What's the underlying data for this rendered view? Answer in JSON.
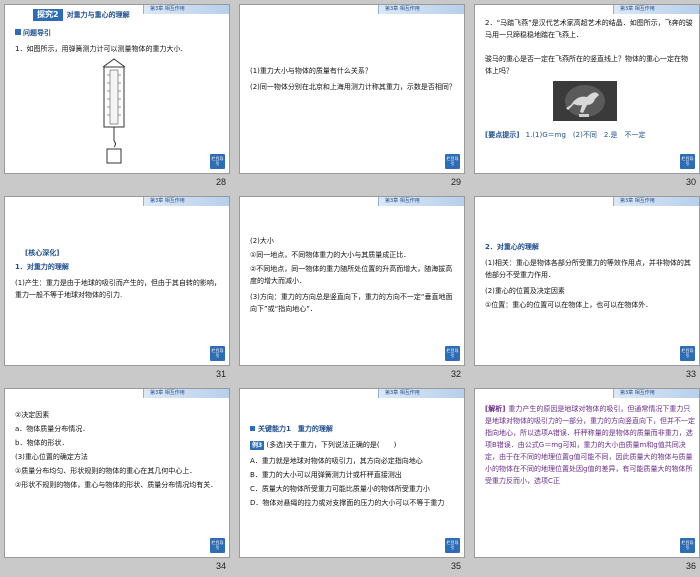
{
  "nav_label": "第3章 相互作用",
  "corner_label": "栏目导引",
  "slides": [
    {
      "number": "28",
      "section_tag": "探究2",
      "section_title": "对重力与重心的理解",
      "subhead": "问题导引",
      "lines": [
        "1．如图所示，用弹簧测力计可以测量物体的重力大小."
      ]
    },
    {
      "number": "29",
      "lines": [
        "(1)重力大小与物体的质量有什么关系？",
        "(2)同一物体分别在北京和上海用测力计称其重力，示数是否相同？"
      ]
    },
    {
      "number": "30",
      "lines": [
        "2．“马踏飞燕”是汉代艺术家高超艺术的结晶．如图所示，飞奔的骏马用一只蹄稳稳地踏在飞燕上．",
        "骏马的重心是否一定在飞燕所在的竖直线上？物体的重心一定在物体上吗？"
      ],
      "tip_label": "[要点提示]",
      "tip_text": "1.(1)G＝mg　(2)不同　2.是　不一定"
    },
    {
      "number": "31",
      "subhead": "[核心深化]",
      "title": "1．对重力的理解",
      "lines": [
        "(1)产生：重力是由于地球的吸引而产生的，但由于其自转的影响，重力一般不等于地球对物体的引力."
      ]
    },
    {
      "number": "32",
      "lines": [
        "(2)大小",
        "①同一地点，不同物体重力的大小与其质量成正比．",
        "②不同地点，同一物体的重力随所处位置的升高而增大，随海拔高度的增大而减小．",
        "(3)方向：重力的方向总是竖直向下，重力的方向不一定“垂直地面向下”或“指向地心”．"
      ]
    },
    {
      "number": "33",
      "title": "2．对重心的理解",
      "lines": [
        "(1)相关：重心是物体各部分所受重力的等效作用点，并非物体的其他部分不受重力作用．",
        "(2)重心的位置及决定因素",
        "①位置：重心的位置可以在物体上，也可以在物体外．"
      ]
    },
    {
      "number": "34",
      "lines": [
        "②决定因素",
        "a．物体质量分布情况．",
        "b．物体的形状．",
        "(3)重心位置的确定方法",
        "①质量分布均匀、形状规则的物体的重心在其几何中心上．",
        "②形状不规则的物体，重心与物体的形状、质量分布情况均有关．"
      ]
    },
    {
      "number": "35",
      "subhead": "关键能力1　重力的理解",
      "example_tag": "例3",
      "question": "(多选)关于重力，下列说法正确的是(　　)",
      "options": [
        "A．重力就是地球对物体的吸引力，其方向必定指向地心",
        "B．重力的大小可以用弹簧测力计或杆秤直接测出",
        "C．质量大的物体所受重力可能比质量小的物体所受重力小",
        "D．物体对悬绳的拉力或对支撑面的压力的大小可以不等于重力"
      ]
    },
    {
      "number": "36",
      "analysis_label": "[解析]",
      "analysis": "重力产生的原因是地球对物体的吸引，但通常情况下重力只是地球对物体的吸引力的一部分，重力的方向竖直向下，但并不一定指向地心，所以选项A错误．杆秤称量的是物体的质量而非重力，选项B错误．由公式G＝mg可知，重力的大小由质量m和g值共同决定，由于在不同的地理位置g值可能不同，因此质量大的物体与质量小的物体在不同的地理位置处因g值的差异，有可能质量大的物体所受重力反而小，选项C正"
    }
  ]
}
